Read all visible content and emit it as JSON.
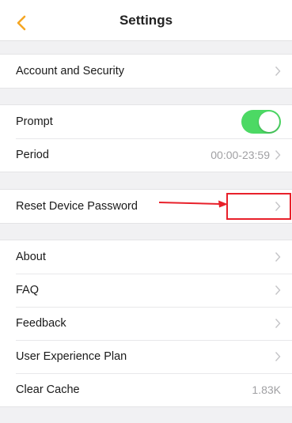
{
  "header": {
    "title": "Settings"
  },
  "groups": [
    {
      "items": [
        {
          "label": "Account and Security"
        }
      ]
    },
    {
      "items": [
        {
          "label": "Prompt",
          "toggle_on": true
        },
        {
          "label": "Period",
          "value": "00:00-23:59"
        }
      ]
    },
    {
      "items": [
        {
          "label": "Reset Device Password"
        }
      ]
    },
    {
      "items": [
        {
          "label": "About"
        },
        {
          "label": "FAQ"
        },
        {
          "label": "Feedback"
        },
        {
          "label": "User Experience Plan"
        },
        {
          "label": "Clear Cache",
          "value": "1.83K"
        }
      ]
    }
  ],
  "colors": {
    "accent": "#f5a623",
    "toggle": "#4cd964",
    "annotation": "#e8202a"
  }
}
